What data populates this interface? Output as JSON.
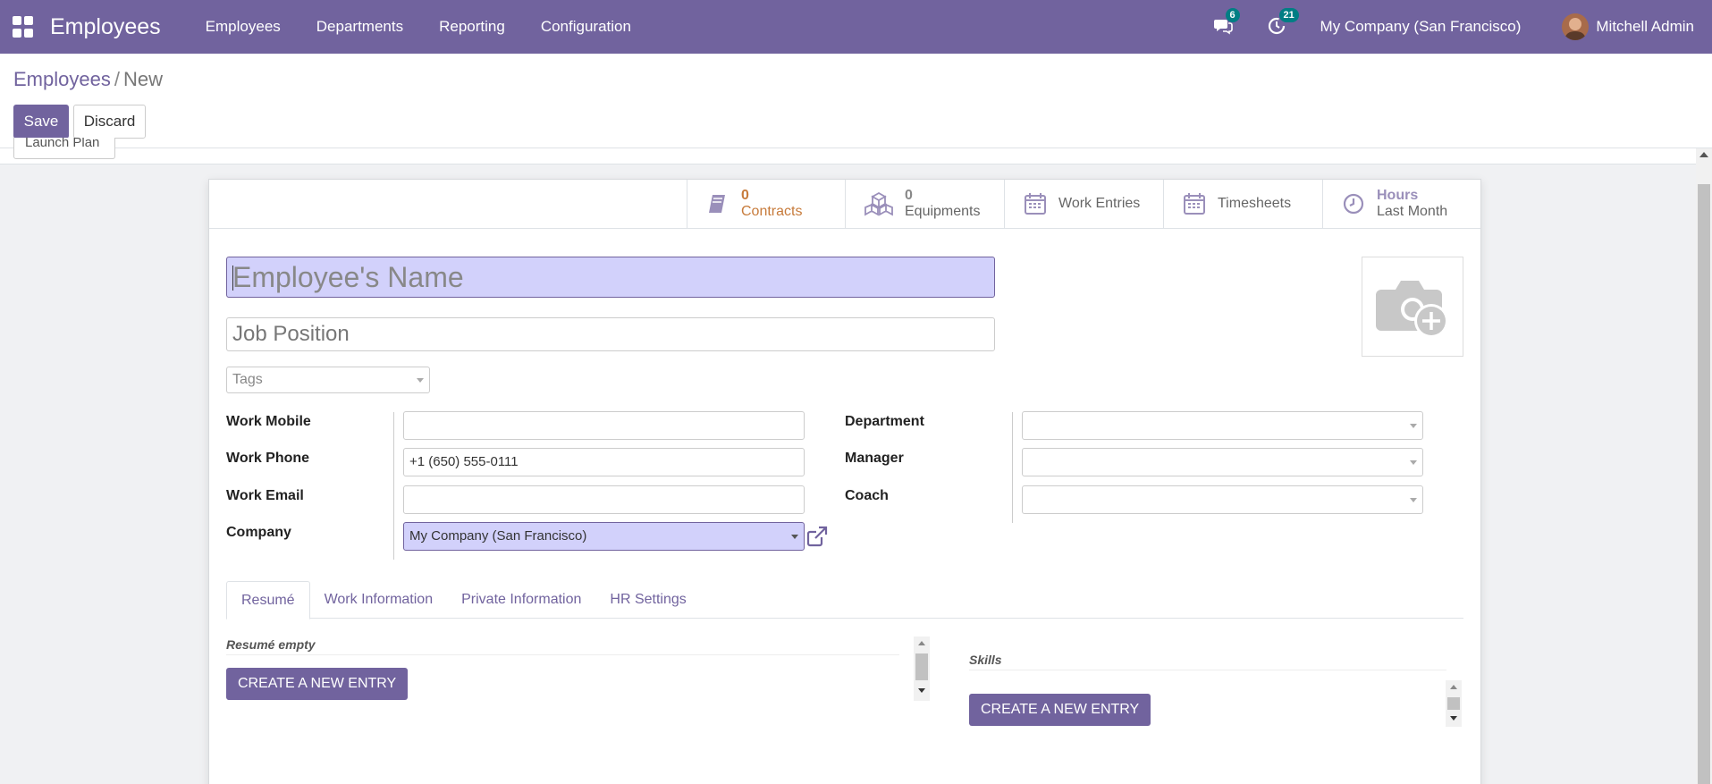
{
  "navbar": {
    "app_name": "Employees",
    "menu": [
      "Employees",
      "Departments",
      "Reporting",
      "Configuration"
    ],
    "messages_count": "6",
    "activities_count": "21",
    "company": "My Company (San Francisco)",
    "user": "Mitchell Admin"
  },
  "control_panel": {
    "breadcrumb_root": "Employees",
    "breadcrumb_separator": "/",
    "breadcrumb_current": "New",
    "save_label": "Save",
    "discard_label": "Discard",
    "launch_plan_label": "Launch Plan"
  },
  "stat_buttons": {
    "contracts": {
      "value": "0",
      "label": "Contracts",
      "color": "#c77b3b"
    },
    "equipments": {
      "value": "0",
      "label": "Equipments"
    },
    "work_entries": {
      "label": "Work Entries"
    },
    "timesheets": {
      "label": "Timesheets"
    },
    "hours": {
      "value": "Hours",
      "label": "Last Month"
    }
  },
  "form": {
    "name_placeholder": "Employee's Name",
    "job_position_placeholder": "Job Position",
    "tags_placeholder": "Tags",
    "left_fields": {
      "work_mobile": {
        "label": "Work Mobile",
        "value": ""
      },
      "work_phone": {
        "label": "Work Phone",
        "value": "+1 (650) 555-0111"
      },
      "work_email": {
        "label": "Work Email",
        "value": ""
      },
      "company": {
        "label": "Company",
        "value": "My Company (San Francisco)"
      }
    },
    "right_fields": {
      "department": {
        "label": "Department",
        "value": ""
      },
      "manager": {
        "label": "Manager",
        "value": ""
      },
      "coach": {
        "label": "Coach",
        "value": ""
      }
    }
  },
  "tabs": [
    "Resumé",
    "Work Information",
    "Private Information",
    "HR Settings"
  ],
  "resume": {
    "empty_label": "Resumé empty",
    "create_label": "CREATE A NEW ENTRY"
  },
  "skills": {
    "title": "Skills",
    "create_label": "CREATE A NEW ENTRY"
  },
  "colors": {
    "brand": "#71639e",
    "highlight": "#d2d1fb",
    "badge": "#017e84"
  }
}
